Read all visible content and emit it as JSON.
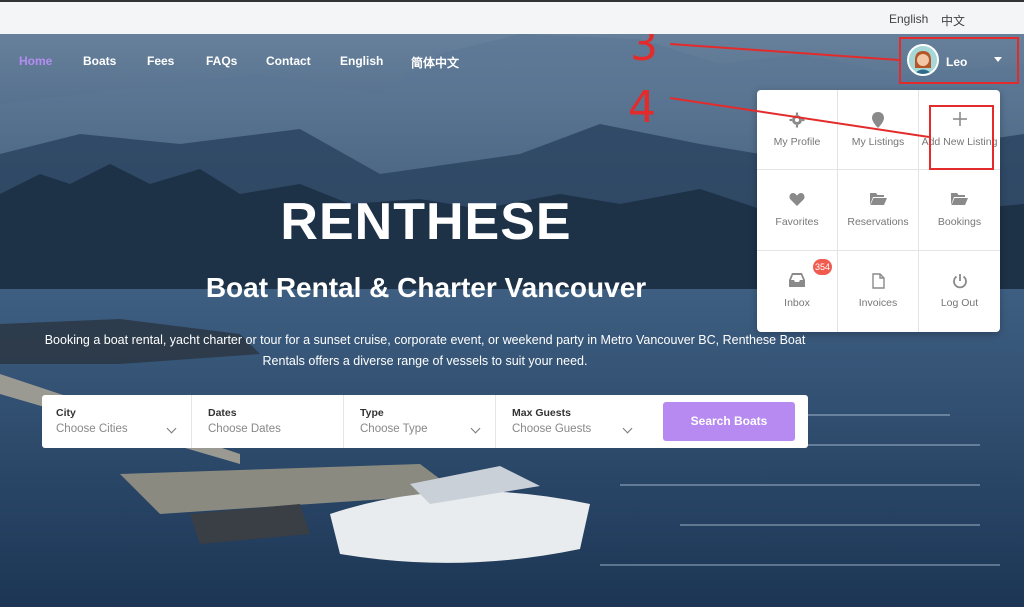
{
  "topbar": {
    "lang_en": "English",
    "lang_zh": "中文"
  },
  "nav": {
    "items": [
      {
        "label": "Home",
        "active": true
      },
      {
        "label": "Boats"
      },
      {
        "label": "Fees"
      },
      {
        "label": "FAQs"
      },
      {
        "label": "Contact"
      },
      {
        "label": "English"
      },
      {
        "label": "简体中文"
      }
    ]
  },
  "user": {
    "name": "Leo"
  },
  "dropdown": {
    "items": [
      {
        "label": "My Profile",
        "icon": "gear-icon"
      },
      {
        "label": "My Listings",
        "icon": "map-pin-icon"
      },
      {
        "label": "Add New Listing",
        "icon": "plus-icon"
      },
      {
        "label": "Favorites",
        "icon": "heart-icon"
      },
      {
        "label": "Reservations",
        "icon": "folder-open-icon"
      },
      {
        "label": "Bookings",
        "icon": "folder-open-icon"
      },
      {
        "label": "Inbox",
        "icon": "inbox-icon",
        "badge": "354"
      },
      {
        "label": "Invoices",
        "icon": "file-icon"
      },
      {
        "label": "Log Out",
        "icon": "power-icon"
      }
    ]
  },
  "annotations": {
    "step3": "3",
    "step4": "4"
  },
  "hero": {
    "title": "RENTHESE",
    "subtitle": "Boat Rental & Charter Vancouver",
    "description": "Booking a boat rental, yacht charter or tour for a sunset cruise, corporate event, or weekend party in Metro Vancouver BC, Renthese Boat Rentals offers a diverse range of vessels to suit your need."
  },
  "search": {
    "city": {
      "label": "City",
      "placeholder": "Choose Cities"
    },
    "dates": {
      "label": "Dates",
      "placeholder": "Choose Dates"
    },
    "type": {
      "label": "Type",
      "placeholder": "Choose Type"
    },
    "guests": {
      "label": "Max Guests",
      "placeholder": "Choose Guests"
    },
    "button": "Search Boats"
  },
  "colors": {
    "accent": "#b68af1",
    "nav_active": "#b58cf3",
    "annotation": "#e32b2b",
    "badge": "#f05b4f"
  }
}
